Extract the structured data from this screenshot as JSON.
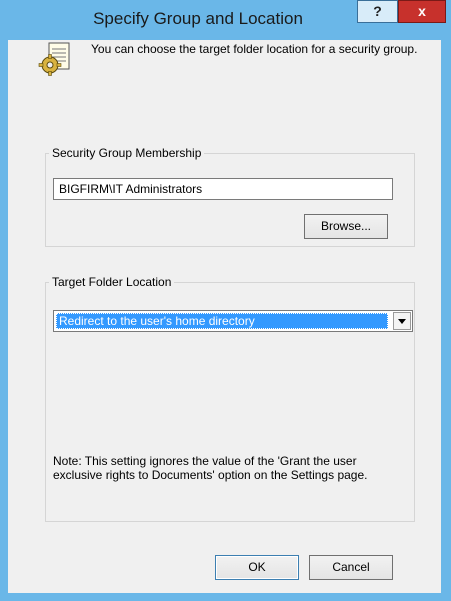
{
  "window": {
    "title": "Specify Group and Location",
    "help_label": "?",
    "close_label": "x"
  },
  "info": {
    "text": "You can choose the target folder location for a security group.",
    "icon": "folder-gear-icon"
  },
  "membership": {
    "legend": "Security Group Membership",
    "group_value": "BIGFIRM\\IT Administrators",
    "browse_label": "Browse..."
  },
  "target": {
    "legend": "Target Folder Location",
    "selected_option": "Redirect to the user's home directory",
    "note": "Note: This setting ignores the value of the 'Grant the user exclusive rights to Documents' option on the Settings page."
  },
  "footer": {
    "ok_label": "OK",
    "cancel_label": "Cancel"
  },
  "colors": {
    "frame": "#6ab7e8",
    "close": "#c7312c",
    "selection": "#3399ff"
  }
}
